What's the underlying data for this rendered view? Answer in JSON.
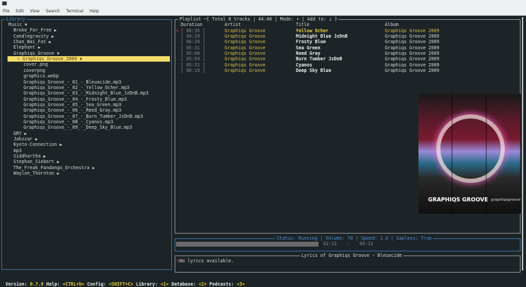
{
  "menu": [
    "File",
    "Edit",
    "View",
    "Search",
    "Terminal",
    "Help"
  ],
  "library": {
    "title": "Library",
    "items": [
      {
        "label": "Music",
        "indent": 1,
        "arrow": "▼"
      },
      {
        "label": "Broke_For_Free",
        "indent": 2,
        "arrow": "▶"
      },
      {
        "label": "Candlegravity",
        "indent": 2,
        "arrow": "▶"
      },
      {
        "label": "Chan_Wai_Fat",
        "indent": 2,
        "arrow": "▶"
      },
      {
        "label": "Elephant",
        "indent": 2,
        "arrow": "▶"
      },
      {
        "label": "Graphiqs_Groove",
        "indent": 2,
        "arrow": "▼"
      },
      {
        "label": "Graphiqs_Groove_2009",
        "indent": 3,
        "arrow": "▼",
        "selected": true
      },
      {
        "label": "cover.png",
        "indent": 4,
        "arrow": ""
      },
      {
        "label": "coverpng",
        "indent": 4,
        "arrow": ""
      },
      {
        "label": "graphics.webp",
        "indent": 4,
        "arrow": ""
      },
      {
        "label": "Graphiqs_Groove_-_01_-_Bleuacide.mp3",
        "indent": 4,
        "arrow": ""
      },
      {
        "label": "Graphiqs_Groove_-_02_-_Yellow_Ocher.mp3",
        "indent": 4,
        "arrow": ""
      },
      {
        "label": "Graphiqs_Groove_-_03_-_Midnight_Blue_JzDnB.mp3",
        "indent": 4,
        "arrow": ""
      },
      {
        "label": "Graphiqs_Groove_-_04_-_Frosty_Blue.mp3",
        "indent": 4,
        "arrow": ""
      },
      {
        "label": "Graphiqs_Groove_-_05_-_Sea_Green.mp3",
        "indent": 4,
        "arrow": ""
      },
      {
        "label": "Graphiqs_Groove_-_06_-_Reed_Gray.mp3",
        "indent": 4,
        "arrow": ""
      },
      {
        "label": "Graphiqs_Groove_-_07_-_Burn_Tumber_JzDnB.mp3",
        "indent": 4,
        "arrow": ""
      },
      {
        "label": "Graphiqs_Groove_-_08_-_Cyanos.mp3",
        "indent": 4,
        "arrow": ""
      },
      {
        "label": "Graphiqs_Groove_-_09_-_Deep_Sky_Blue.mp3",
        "indent": 4,
        "arrow": ""
      },
      {
        "label": "GRY",
        "indent": 2,
        "arrow": "▶"
      },
      {
        "label": "Jahzzar",
        "indent": 2,
        "arrow": "▶"
      },
      {
        "label": "Kyoto-Connection",
        "indent": 2,
        "arrow": "▶"
      },
      {
        "label": "mp3",
        "indent": 2,
        "arrow": ""
      },
      {
        "label": "Siddhartha",
        "indent": 2,
        "arrow": "▶"
      },
      {
        "label": "Stephan_Siebert",
        "indent": 2,
        "arrow": "▶"
      },
      {
        "label": "The_Freak_Fandango_Orchestra",
        "indent": 2,
        "arrow": "▶"
      },
      {
        "label": "Waylon_Thornton",
        "indent": 2,
        "arrow": "▶"
      }
    ]
  },
  "playlist": {
    "title": "Playlist",
    "info": "Total 8 tracks | 44:48 | Mode: ⬇ | Add to: ⊥",
    "headers": {
      "duration": "Duration",
      "artist": "Artist",
      "title": "Title",
      "album": "Album"
    },
    "tracks": [
      {
        "duration": "[ 06:35 ]",
        "artist": "Graphiqs Groove",
        "title": "Yellow Ocher",
        "album": "Graphiqs Groove 2009",
        "current": true
      },
      {
        "duration": "[ 04:29 ]",
        "artist": "Graphiqs Groove",
        "title": "Midnight Blue JzDnB",
        "album": "Graphiqs Groove 2009"
      },
      {
        "duration": "[ 06:20 ]",
        "artist": "Graphiqs Groove",
        "title": "Frosty Blue",
        "album": "Graphiqs Groove 2009"
      },
      {
        "duration": "[ 05:31 ]",
        "artist": "Graphiqs Groove",
        "title": "Sea Green",
        "album": "Graphiqs Groove 2009"
      },
      {
        "duration": "[ 05:00 ]",
        "artist": "Graphiqs Groove",
        "title": "Reed Gray",
        "album": "Graphiqs Groove 2009"
      },
      {
        "duration": "[ 05:03 ]",
        "artist": "Graphiqs Groove",
        "title": "Burn Tumber JzDnB",
        "album": "Graphiqs Groove 2009"
      },
      {
        "duration": "[ 05:31 ]",
        "artist": "Graphiqs Groove",
        "title": "Cyanos",
        "album": "Graphiqs Groove 2009"
      },
      {
        "duration": "[ 06:19 ]",
        "artist": "Graphiqs Groove",
        "title": "Deep Sky Blue",
        "album": "Graphiqs Groove 2009"
      }
    ]
  },
  "album_art": {
    "brand": "GRAPHIQS GROOVE",
    "handle": "graphiqsgroove"
  },
  "status": {
    "title": "Status: Running | Volume: 70 | Speed: 1.0 | Gapless: True",
    "elapsed": "02:12",
    "separator": "-",
    "total": "05:13",
    "progress": 0.42
  },
  "lyrics": {
    "title": "Lyrics of Graphiqs Groove - Bleuacide",
    "text": "No lyrics available."
  },
  "statusline": [
    {
      "label": "Version: ",
      "value": "0.7.8"
    },
    {
      "label": " Help: ",
      "key": "<CTRL+h>"
    },
    {
      "label": " Config: ",
      "key": "<SHIFT+C>"
    },
    {
      "label": " Library: ",
      "key": "<1>"
    },
    {
      "label": " Database: ",
      "key": "<2>"
    },
    {
      "label": " Podcasts: ",
      "key": "<3>"
    }
  ]
}
